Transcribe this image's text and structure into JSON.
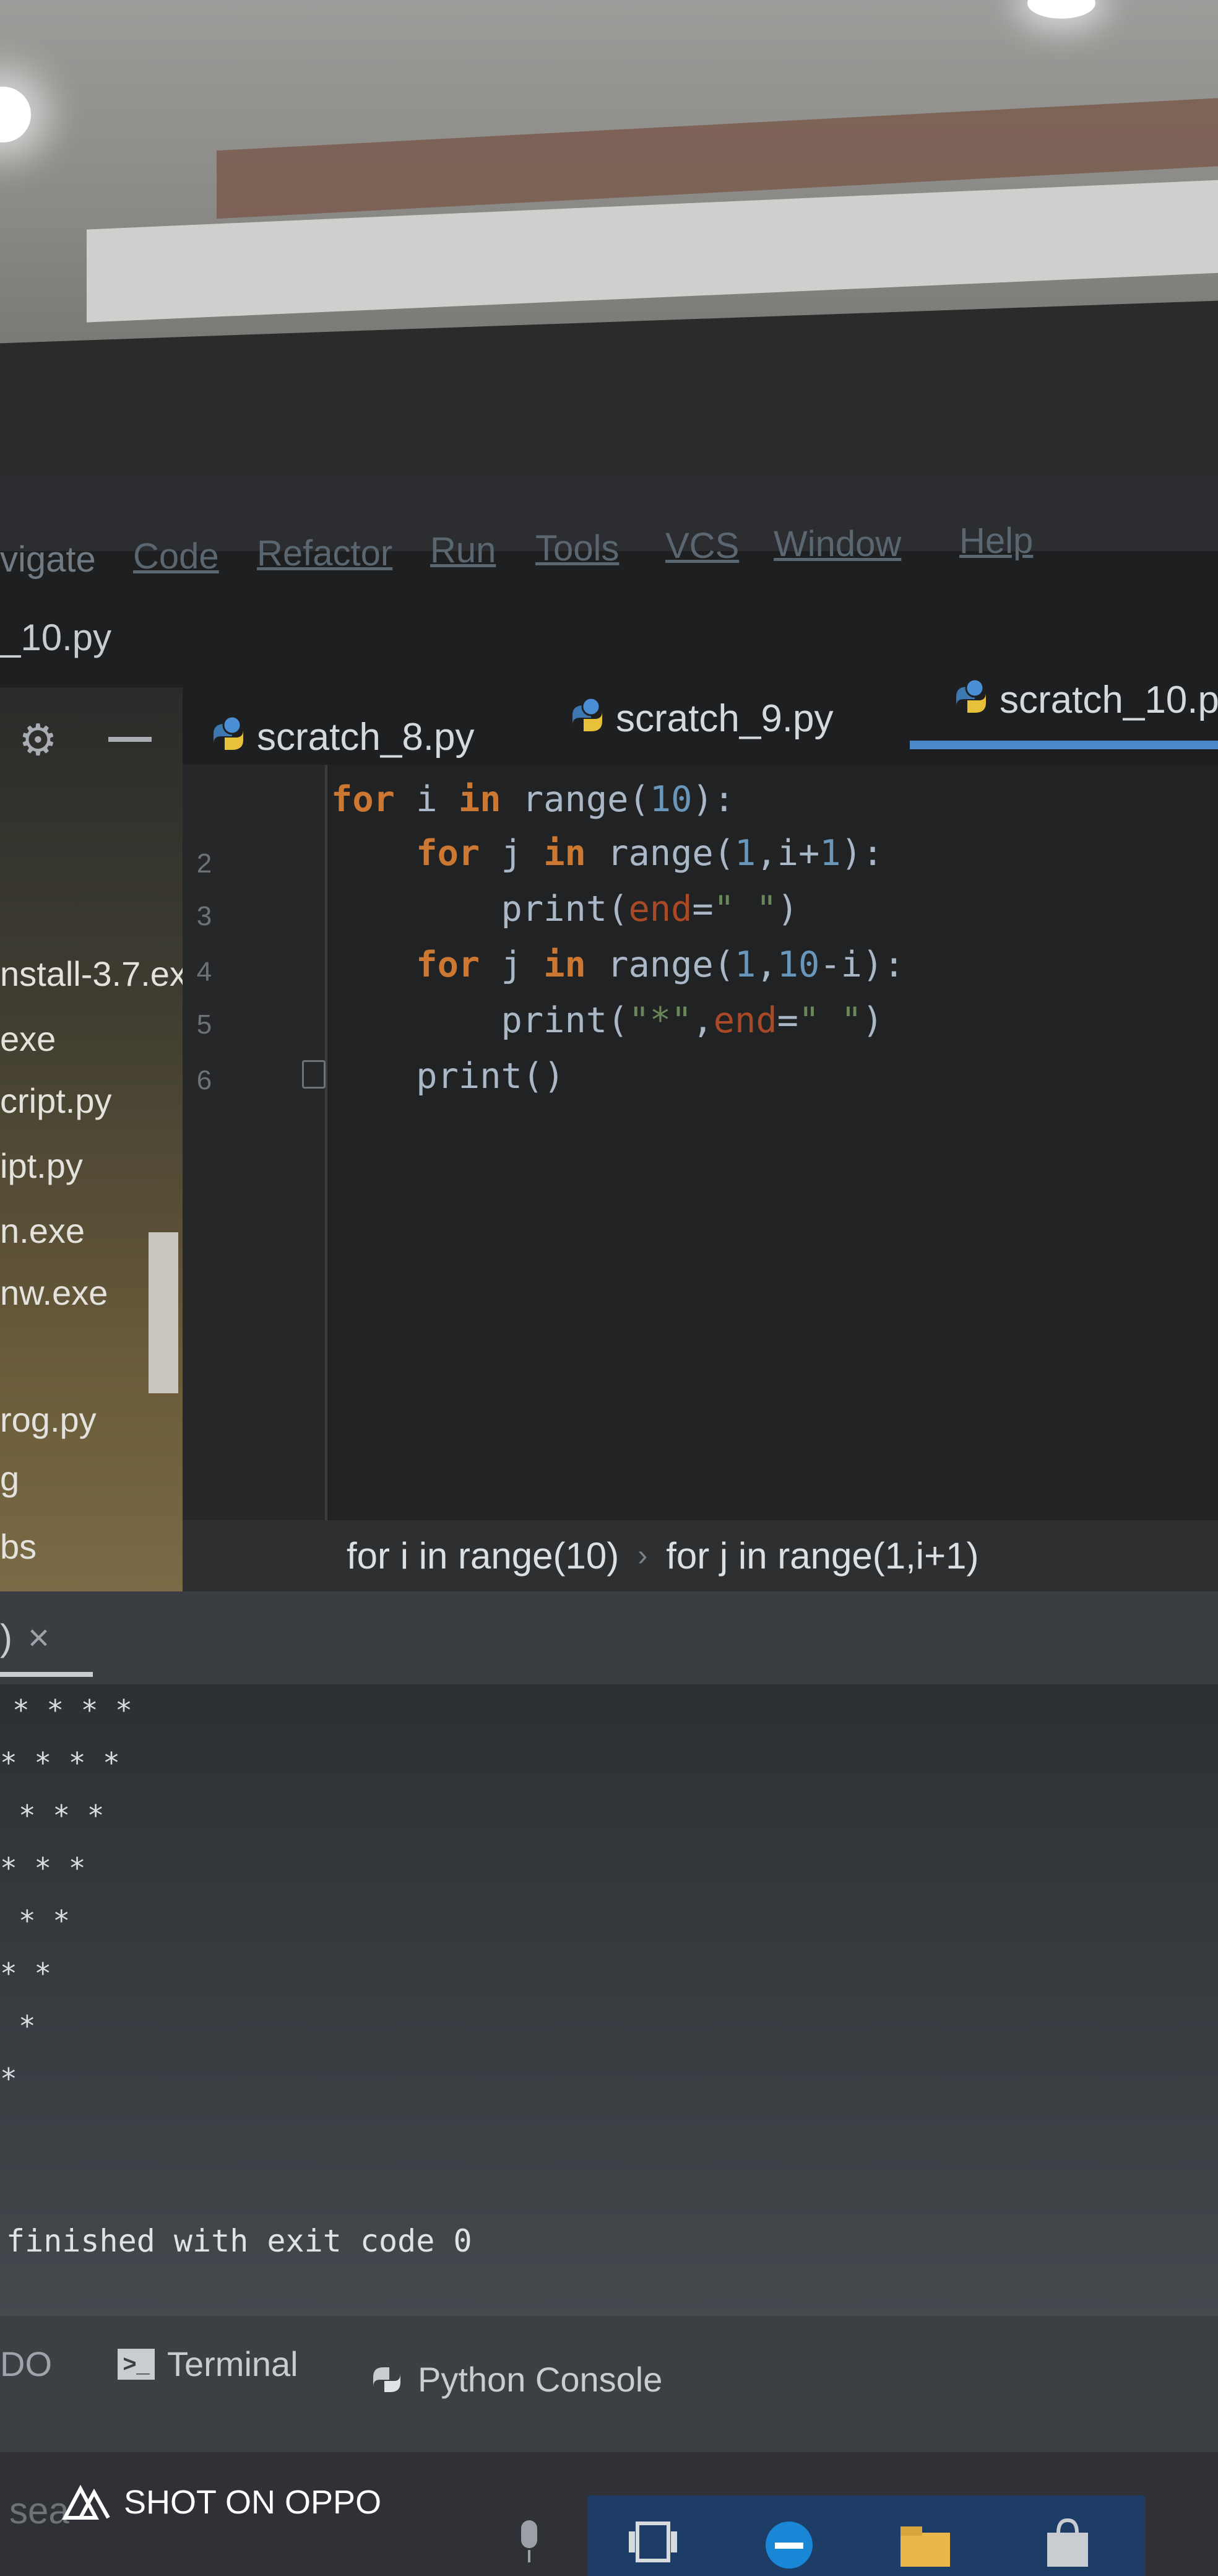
{
  "menu": {
    "items": [
      "vigate",
      "Code",
      "Refactor",
      "Run",
      "Tools",
      "VCS",
      "Window",
      "Help"
    ]
  },
  "window_title": "_10.py",
  "sidebar": {
    "files": [
      "nstall-3.7.ex",
      "exe",
      "cript.py",
      "ipt.py",
      "n.exe",
      "nw.exe",
      "rog.py",
      "g",
      "bs"
    ]
  },
  "tabs": [
    {
      "label": "scratch_8.py"
    },
    {
      "label": "scratch_9.py"
    },
    {
      "label": "scratch_10.p"
    }
  ],
  "editor": {
    "line_numbers": [
      "2",
      "3",
      "4",
      "5",
      "6"
    ],
    "code": [
      "for i in range(10):",
      "    for j in range(1,i+1):",
      "        print(end=\" \")",
      "    for j in range(1,10-i):",
      "        print(\"*\",end=\" \")",
      "    print()"
    ]
  },
  "breadcrumb": {
    "items": [
      "for i in range(10)",
      "for j in range(1,i+1)"
    ],
    "separator": "›"
  },
  "run_panel": {
    "tab_label": ")",
    "close_glyph": "×",
    "output_lines": [
      "* * * *",
      "* * * *",
      "* * *",
      "* * *",
      "* *",
      "* *",
      "*",
      "*"
    ],
    "exit_message": "finished with exit code 0"
  },
  "bottom_tabs": {
    "todo": "DO",
    "terminal": "Terminal",
    "python_console": "Python Console"
  },
  "taskbar": {
    "search_text": "sea",
    "watermark": "SHOT ON OPPO"
  },
  "colors": {
    "keyword": "#cc7832",
    "number": "#6897bb",
    "string": "#6a8759",
    "keyword_arg": "#aa4926",
    "tab_underline": "#4a88c7"
  },
  "icons": [
    "gear-icon",
    "minus-icon",
    "python-file-icon",
    "fold-icon",
    "terminal-icon",
    "python-console-icon",
    "edge-browser-icon",
    "folder-icon",
    "task-view-icon",
    "microphone-icon"
  ]
}
